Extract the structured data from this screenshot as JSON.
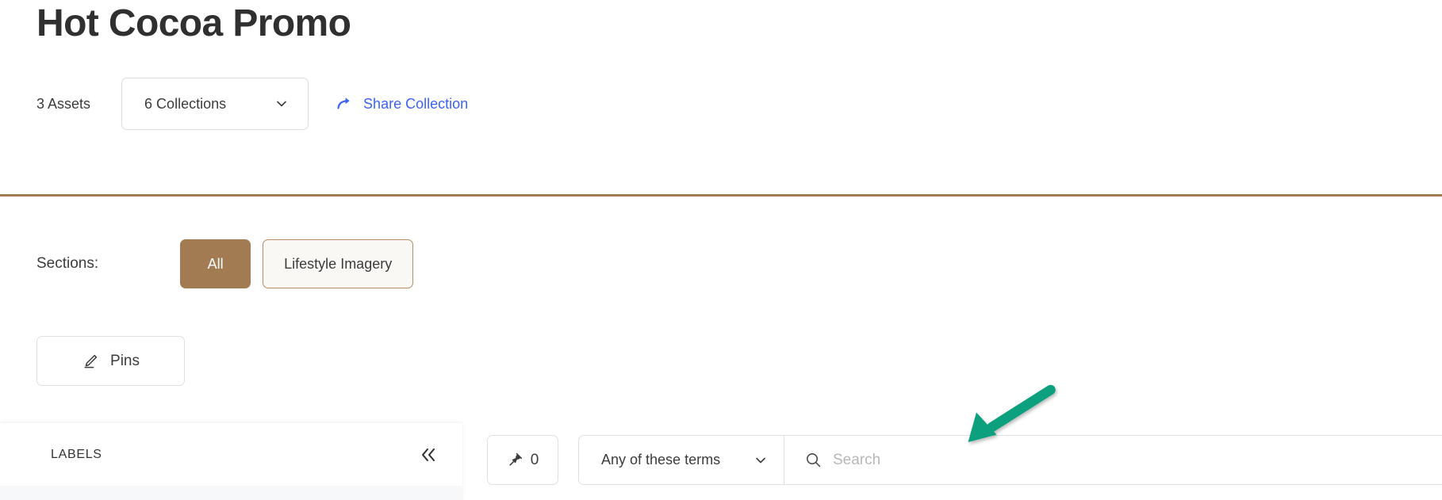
{
  "header": {
    "title": "Hot Cocoa Promo",
    "asset_count": "3 Assets",
    "collections_select": {
      "value": "6 Collections",
      "chevron_icon": "chevron-down-icon"
    },
    "share_link": {
      "label": "Share Collection",
      "icon": "share-arrow-icon",
      "color": "#3b62f6"
    },
    "divider_color": "#a27b53"
  },
  "sections": {
    "label": "Sections:",
    "chips": [
      {
        "label": "All",
        "active": true
      },
      {
        "label": "Lifestyle Imagery",
        "active": false
      }
    ],
    "active_color": "#a27b53",
    "inactive_bg": "#faf8f5",
    "inactive_border": "#b58e66"
  },
  "pins_button": {
    "label": "Pins",
    "icon": "pencil-icon"
  },
  "labels_panel": {
    "title": "LABELS",
    "collapse_icon": "chevron-double-left-icon"
  },
  "search_toolbar": {
    "pin_count": {
      "icon": "pushpin-icon",
      "value": "0"
    },
    "terms_select": {
      "value": "Any of these terms",
      "chevron_icon": "chevron-down-icon"
    },
    "search": {
      "icon": "search-icon",
      "value": "",
      "placeholder": "Search"
    }
  },
  "annotation": {
    "type": "arrow",
    "color": "#0da07e",
    "points_to": "search-input",
    "direction": "down-left"
  }
}
